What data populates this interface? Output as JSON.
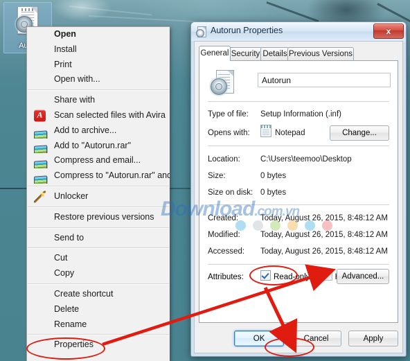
{
  "desktop": {
    "icon": {
      "label": "Aut...",
      "name": "Autorun"
    }
  },
  "context_menu": {
    "groups": [
      {
        "items": [
          {
            "label": "Open",
            "bold": true,
            "icon": "none"
          },
          {
            "label": "Install",
            "bold": false,
            "icon": "none"
          },
          {
            "label": "Print",
            "bold": false,
            "icon": "none"
          },
          {
            "label": "Open with...",
            "bold": false,
            "icon": "none"
          }
        ]
      },
      {
        "items": [
          {
            "label": "Share with",
            "bold": false,
            "icon": "none"
          },
          {
            "label": "Scan selected files with Avira",
            "bold": false,
            "icon": "avira-icon"
          },
          {
            "label": "Add to archive...",
            "bold": false,
            "icon": "winrar-icon"
          },
          {
            "label": "Add to \"Autorun.rar\"",
            "bold": false,
            "icon": "winrar-icon"
          },
          {
            "label": "Compress and email...",
            "bold": false,
            "icon": "winrar-icon"
          },
          {
            "label": "Compress to \"Autorun.rar\" and email",
            "bold": false,
            "icon": "winrar-icon"
          }
        ]
      },
      {
        "items": [
          {
            "label": "Unlocker",
            "bold": false,
            "icon": "magic-wand-icon"
          }
        ]
      },
      {
        "items": [
          {
            "label": "Restore previous versions",
            "bold": false,
            "icon": "none"
          }
        ]
      },
      {
        "items": [
          {
            "label": "Send to",
            "bold": false,
            "icon": "none"
          }
        ]
      },
      {
        "items": [
          {
            "label": "Cut",
            "bold": false,
            "icon": "none"
          },
          {
            "label": "Copy",
            "bold": false,
            "icon": "none"
          }
        ]
      },
      {
        "items": [
          {
            "label": "Create shortcut",
            "bold": false,
            "icon": "none"
          },
          {
            "label": "Delete",
            "bold": false,
            "icon": "none"
          },
          {
            "label": "Rename",
            "bold": false,
            "icon": "none"
          }
        ]
      },
      {
        "items": [
          {
            "label": "Properties",
            "bold": false,
            "icon": "none",
            "highlighted": true
          }
        ]
      }
    ]
  },
  "dialog": {
    "title": "Autorun Properties",
    "close_label": "x",
    "tabs": [
      {
        "label": "General",
        "active": true
      },
      {
        "label": "Security",
        "active": false
      },
      {
        "label": "Details",
        "active": false
      },
      {
        "label": "Previous Versions",
        "active": false
      }
    ],
    "filename": "Autorun",
    "fields": [
      {
        "label": "Type of file:",
        "value": "Setup Information (.inf)"
      },
      {
        "label": "Opens with:",
        "value": "Notepad"
      },
      {
        "label": "Location:",
        "value": "C:\\Users\\teemoo\\Desktop"
      },
      {
        "label": "Size:",
        "value": "0 bytes"
      },
      {
        "label": "Size on disk:",
        "value": "0 bytes"
      },
      {
        "label": "Created:",
        "value": "Today, August 26, 2015, 8:48:12 AM"
      },
      {
        "label": "Modified:",
        "value": "Today, August 26, 2015, 8:48:12 AM"
      },
      {
        "label": "Accessed:",
        "value": "Today, August 26, 2015, 8:48:12 AM"
      }
    ],
    "change_button": "Change...",
    "attributes": {
      "label": "Attributes:",
      "read_only": {
        "label": "Read-only",
        "checked": true
      },
      "hidden": {
        "label": "Hidden",
        "checked": false
      },
      "advanced_button": "Advanced..."
    },
    "buttons": {
      "ok": "OK",
      "cancel": "Cancel",
      "apply": "Apply"
    }
  },
  "watermark": {
    "main": "Download",
    "suffix": ".com.vn",
    "dot_colors": [
      "#7ec8e8",
      "#cfd4d8",
      "#b6dc8e",
      "#f5c87e",
      "#7ec8e8",
      "#f49a9a"
    ]
  },
  "annotations": {
    "accent_color": "#e01b10"
  }
}
